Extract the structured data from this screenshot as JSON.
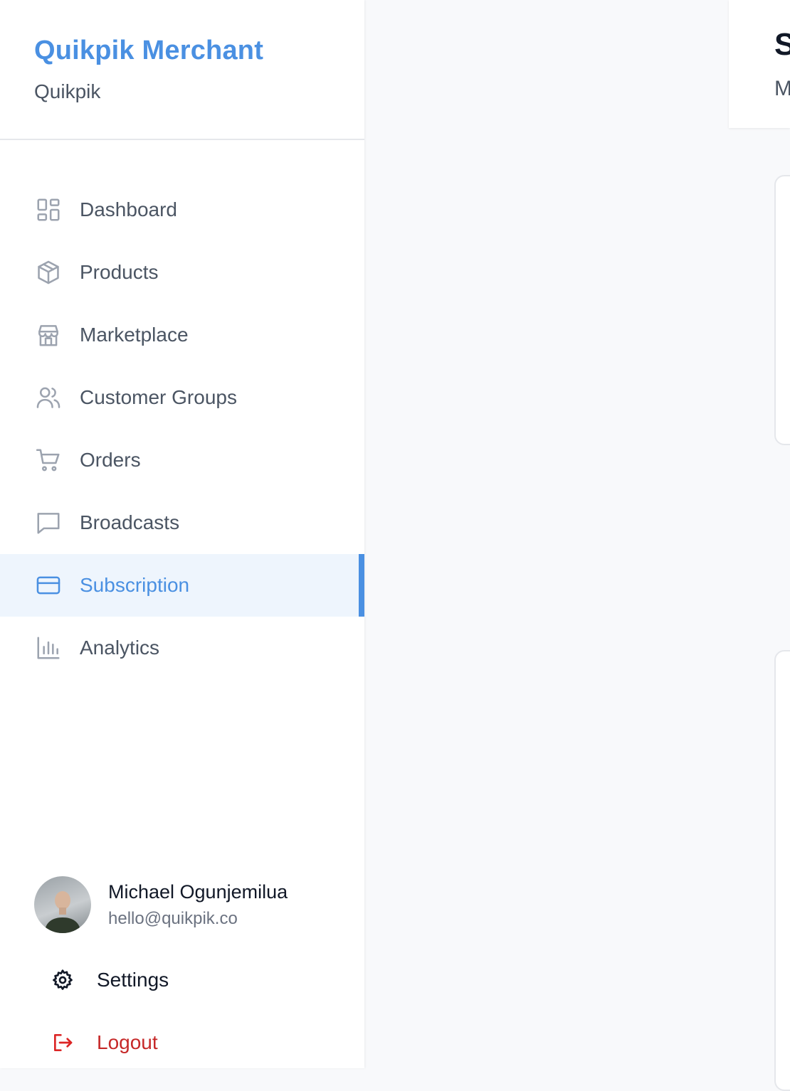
{
  "brand": {
    "title": "Quikpik Merchant",
    "subtitle": "Quikpik"
  },
  "nav": [
    {
      "label": "Dashboard",
      "icon": "dashboard-icon",
      "active": false
    },
    {
      "label": "Products",
      "icon": "box-icon",
      "active": false
    },
    {
      "label": "Marketplace",
      "icon": "store-icon",
      "active": false
    },
    {
      "label": "Customer Groups",
      "icon": "users-icon",
      "active": false
    },
    {
      "label": "Orders",
      "icon": "cart-icon",
      "active": false
    },
    {
      "label": "Broadcasts",
      "icon": "message-icon",
      "active": false
    },
    {
      "label": "Subscription",
      "icon": "credit-card-icon",
      "active": true
    },
    {
      "label": "Analytics",
      "icon": "bar-chart-icon",
      "active": false
    }
  ],
  "user": {
    "name": "Michael Ogunjemilua",
    "email": "hello@quikpik.co"
  },
  "bottom": {
    "settings_label": "Settings",
    "logout_label": "Logout"
  },
  "main": {
    "title_partial": "S",
    "subtitle_partial": "M"
  },
  "colors": {
    "accent": "#4a90e2",
    "logout": "#c62828",
    "active_bg": "#eef5fd"
  }
}
